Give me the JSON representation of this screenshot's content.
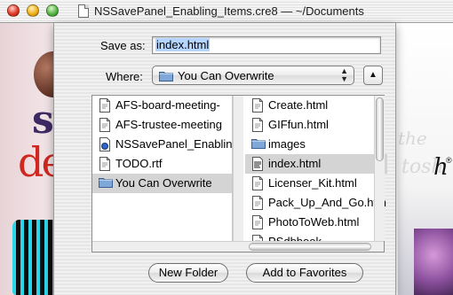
{
  "window": {
    "title": "NSSavePanel_Enabling_Items.cre8  —  ~/Documents"
  },
  "background": {
    "text_tail_the": "the",
    "text_tail_tosh": "tosh",
    "text_h": "h",
    "text_reg": "®"
  },
  "sheet": {
    "save_as_label": "Save as:",
    "save_as_value": "index.html",
    "where_label": "Where:",
    "where_value": "You Can Overwrite",
    "toggle_label": "▲"
  },
  "browser": {
    "column1": [
      {
        "name": "AFS-board-meeting-",
        "icon": "document-icon",
        "selected": false
      },
      {
        "name": "AFS-trustee-meeting",
        "icon": "document-icon",
        "selected": false
      },
      {
        "name": "NSSavePanel_Enablin",
        "icon": "app-document-icon",
        "selected": false
      },
      {
        "name": "TODO.rtf",
        "icon": "document-icon",
        "selected": false
      },
      {
        "name": "You Can Overwrite",
        "icon": "folder-icon",
        "selected": true
      }
    ],
    "column2": [
      {
        "name": "Create.html",
        "icon": "document-icon",
        "selected": false
      },
      {
        "name": "GIFfun.html",
        "icon": "document-icon",
        "selected": false
      },
      {
        "name": "images",
        "icon": "folder-icon",
        "selected": false
      },
      {
        "name": "index.html",
        "icon": "html-document-icon",
        "selected": true
      },
      {
        "name": "Licenser_Kit.html",
        "icon": "document-icon",
        "selected": false
      },
      {
        "name": "Pack_Up_And_Go.htm",
        "icon": "document-icon",
        "selected": false
      },
      {
        "name": "PhotoToWeb.html",
        "icon": "document-icon",
        "selected": false
      },
      {
        "name": "PSdbbook...",
        "icon": "document-icon",
        "selected": false
      }
    ]
  },
  "buttons": {
    "new_folder": "New Folder",
    "add_to_favorites": "Add to Favorites"
  },
  "colors": {
    "selection_highlight": "#d4d4d4",
    "text_selection": "#b5d5ff",
    "folder_blue": "#7fa7d8"
  }
}
